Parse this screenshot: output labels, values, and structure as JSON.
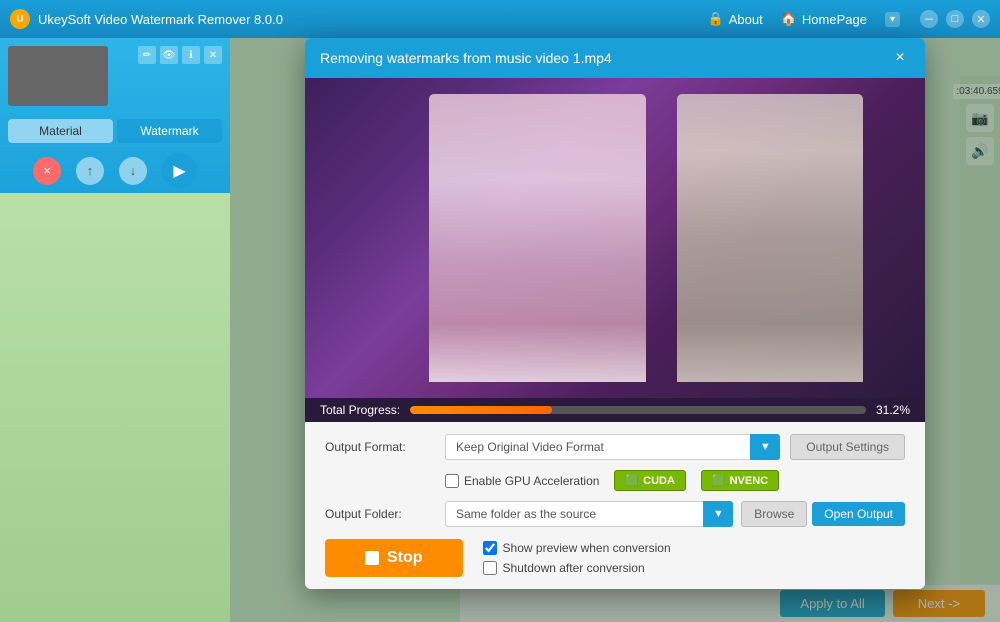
{
  "app": {
    "title": "UkeySoft Video Watermark Remover 8.0.0",
    "logo_text": "U"
  },
  "titlebar": {
    "about_label": "About",
    "homepage_label": "HomePage",
    "dropdown_label": "▾"
  },
  "sidebar": {
    "material_tab": "Material",
    "watermark_tab": "Watermark",
    "delete_btn": "×",
    "up_btn": "↑",
    "down_btn": "↓"
  },
  "dialog": {
    "title": "Removing watermarks from music video 1.mp4",
    "close_btn": "×",
    "progress_label": "Total Progress:",
    "progress_pct": "31.2%",
    "progress_value": 31.2,
    "output_format_label": "Output Format:",
    "output_format_value": "Keep Original Video Format",
    "output_settings_label": "Output Settings",
    "enable_gpu_label": "Enable GPU Acceleration",
    "cuda_label": "CUDA",
    "nvenc_label": "NVENC",
    "output_folder_label": "Output Folder:",
    "output_folder_value": "Same folder as the source",
    "browse_label": "Browse",
    "open_output_label": "Open Output",
    "stop_label": "Stop",
    "show_preview_label": "Show preview when conversion",
    "shutdown_label": "Shutdown after conversion"
  },
  "bottom_bar": {
    "apply_all_label": "Apply to All",
    "next_label": "Next ->"
  },
  "right_panel": {
    "time": ":03:40.659"
  },
  "icons": {
    "lock": "🔒",
    "home": "🏠",
    "edit": "✏",
    "eye": "👁",
    "info": "ℹ",
    "close_x": "✕",
    "play": "▶",
    "camera": "📷",
    "volume": "🔊",
    "stop_square": "■",
    "nvidia": "🟢"
  }
}
